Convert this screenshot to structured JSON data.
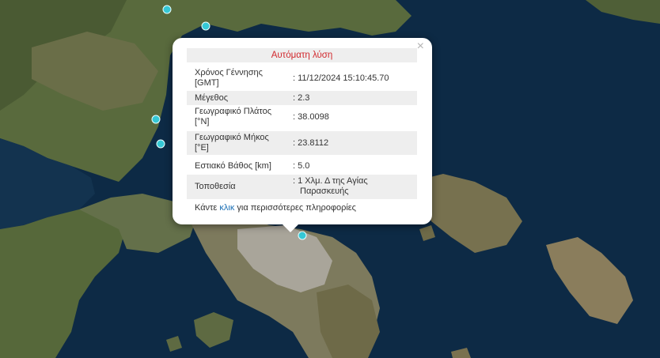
{
  "popup": {
    "title": "Αυτόματη λύση",
    "close_symbol": "×",
    "rows": [
      {
        "label_line1": "Χρόνος Γέννησης",
        "label_line2": "[GMT]",
        "value": ": 11/12/2024 15:10:45.70"
      },
      {
        "label_line1": "Μέγεθος",
        "label_line2": "",
        "value": ": 2.3"
      },
      {
        "label_line1": "Γεωγραφικό Πλάτος",
        "label_line2": "[°N]",
        "value": ": 38.0098"
      },
      {
        "label_line1": "Γεωγραφικό Μήκος",
        "label_line2": "[°E]",
        "value": ": 23.8112"
      },
      {
        "label_line1": "Εστιακό Βάθος [km]",
        "label_line2": "",
        "value": ": 5.0"
      },
      {
        "label_line1": "Τοποθεσία",
        "label_line2": "",
        "value": ": 1 Χλμ. Δ της Αγίας",
        "value2": "Παρασκευής"
      }
    ],
    "footer": {
      "prefix": "Κάντε ",
      "link": "κλικ",
      "suffix": " για περισσότερες πληροφορίες"
    }
  },
  "map": {
    "sea_color": "#0d2a45",
    "land_color": "#5a6a3c",
    "urban_color": "#a9a59a",
    "marker_color": "#35c8d6"
  }
}
